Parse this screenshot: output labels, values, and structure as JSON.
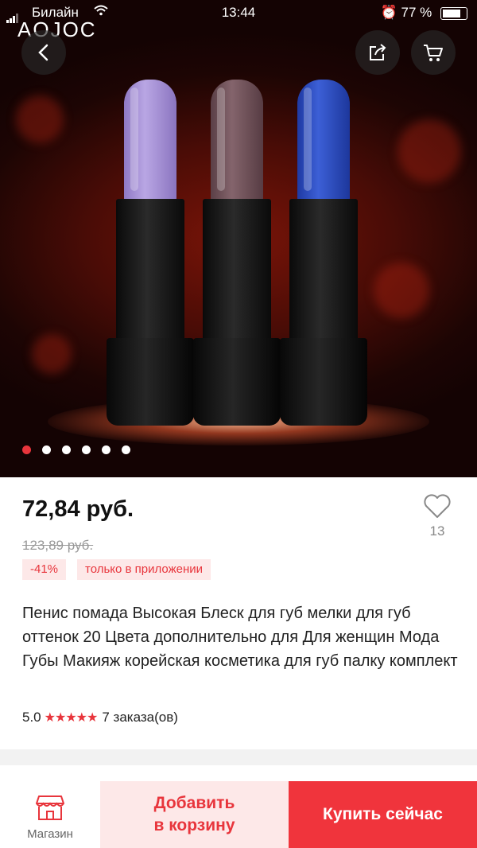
{
  "status_bar": {
    "carrier": "Билайн",
    "time": "13:44",
    "battery": "77 %"
  },
  "brand": "AOJOC",
  "icons": {
    "back": "chevron-left-icon",
    "share": "share-icon",
    "cart": "cart-icon",
    "heart": "heart-icon",
    "store": "store-icon"
  },
  "gallery": {
    "active_index": 0,
    "dots": [
      0,
      1,
      2,
      3,
      4,
      5
    ]
  },
  "product": {
    "price": "72,84 руб.",
    "old_price": "123,89 руб.",
    "discount": "-41%",
    "app_only": "только в приложении",
    "wishlist_count": "13",
    "title": "Пенис помада Высокая Блеск для губ мелки для губ оттенок 20 Цвета дополнительно для Для женщин Мода Губы Макияж корейская косметика для губ палку комплект",
    "rating": "5.0",
    "stars": "★★★★★",
    "orders": "7 заказа(ов)"
  },
  "bottom_bar": {
    "store_label": "Магазин",
    "add_to_cart_line1": "Добавить",
    "add_to_cart_line2": "в корзину",
    "buy_now": "Купить сейчас"
  },
  "colors": {
    "accent": "#f0343c",
    "accent_light": "#fde8e8",
    "lipstick_colors": [
      "#a792d6",
      "#6e5058",
      "#2b48b8"
    ]
  }
}
